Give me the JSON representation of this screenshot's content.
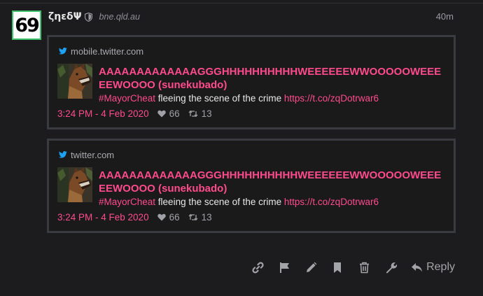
{
  "post": {
    "username": "ζηεδΨ",
    "domain": "bne.qld.au",
    "time": "40m",
    "avatar_text": "69"
  },
  "oneboxes": [
    {
      "source": "mobile.twitter.com",
      "title": "AAAAAAAAAAAAAGGGHHHHHHHHHHWEEEEEEWWOOOOOWEEEEEWOOOO (sunekubado)",
      "hashtag": "#MayorCheat",
      "text": " fleeing the scene of the crime ",
      "link": "https://t.co/zqDotrwar6",
      "date": "3:24 PM - 4 Feb 2020",
      "likes": "66",
      "retweets": "13"
    },
    {
      "source": "twitter.com",
      "title": "AAAAAAAAAAAAAGGGHHHHHHHHHHWEEEEEEWWOOOOOWEEEEEWOOOO (sunekubado)",
      "hashtag": "#MayorCheat",
      "text": " fleeing the scene of the crime ",
      "link": "https://t.co/zqDotrwar6",
      "date": "3:24 PM - 4 Feb 2020",
      "likes": "66",
      "retweets": "13"
    }
  ],
  "actions": {
    "reply_label": "Reply",
    "icons": [
      "link-icon",
      "flag-icon",
      "pencil-icon",
      "bookmark-icon",
      "trash-icon",
      "wrench-icon"
    ]
  },
  "colors": {
    "accent_pink": "#ff4b8b",
    "twitter_blue": "#1da1f2",
    "avatar_border": "#3ec46d"
  }
}
